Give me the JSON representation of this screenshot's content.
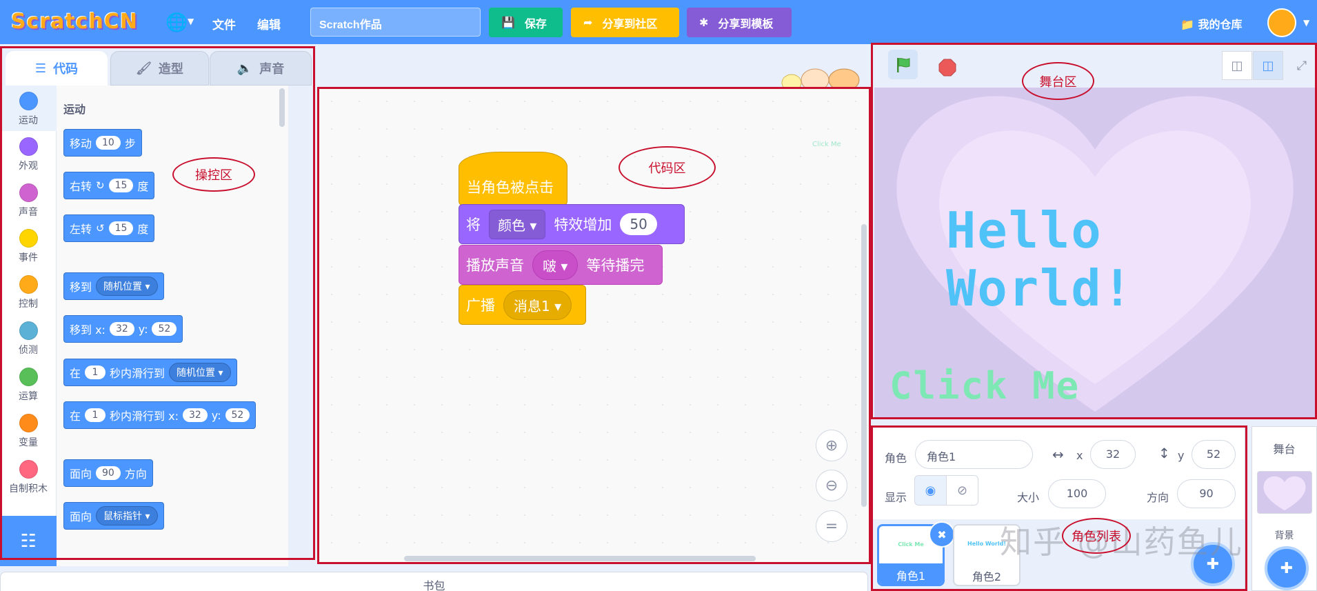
{
  "menubar": {
    "logo": "ScratchCN",
    "menu_file": "文件",
    "menu_edit": "编辑",
    "project_title": "Scratch作品",
    "save_label": "保存",
    "share_community_label": "分享到社区",
    "share_template_label": "分享到模板",
    "my_stuff_label": "我的仓库",
    "bar_color": "#4c97ff"
  },
  "editor_tabs": {
    "code": "代码",
    "costumes": "造型",
    "sounds": "声音"
  },
  "categories": [
    {
      "label": "运动",
      "color": "#4c97ff"
    },
    {
      "label": "外观",
      "color": "#9966ff"
    },
    {
      "label": "声音",
      "color": "#cf63cf"
    },
    {
      "label": "事件",
      "color": "#ffd500"
    },
    {
      "label": "控制",
      "color": "#ffab19"
    },
    {
      "label": "侦测",
      "color": "#5cb1d6"
    },
    {
      "label": "运算",
      "color": "#59c059"
    },
    {
      "label": "变量",
      "color": "#ff8c1a"
    },
    {
      "label": "自制积木",
      "color": "#ff6680"
    }
  ],
  "palette": {
    "heading": "运动",
    "move": {
      "a": "移动",
      "n": "10",
      "b": "步"
    },
    "turn_right": {
      "a": "右转",
      "n": "15",
      "b": "度"
    },
    "turn_left": {
      "a": "左转",
      "n": "15",
      "b": "度"
    },
    "goto": {
      "a": "移到",
      "drop": "随机位置"
    },
    "goto_xy": {
      "a": "移到 x:",
      "x": "32",
      "ylab": "y:",
      "y": "52"
    },
    "glide": {
      "a": "在",
      "n": "1",
      "b": "秒内滑行到",
      "drop": "随机位置"
    },
    "glide_xy": {
      "a": "在",
      "n": "1",
      "b": "秒内滑行到 x:",
      "x": "32",
      "ylab": "y:",
      "y": "52"
    },
    "point_dir": {
      "a": "面向",
      "n": "90",
      "b": "方向"
    },
    "point_towards": {
      "a": "面向",
      "drop": "鼠标指针"
    }
  },
  "script": {
    "hat": "当角色被点击",
    "effect": {
      "a": "将",
      "drop": "颜色",
      "b": "特效增加",
      "n": "50"
    },
    "sound": {
      "a": "播放声音",
      "drop": "啵",
      "b": "等待播完"
    },
    "broadcast": {
      "a": "广播",
      "drop": "消息1"
    }
  },
  "stage": {
    "hello_text": "Hello World!",
    "click_text": "Click Me",
    "mini_click_text": "Click Me"
  },
  "sprite_info": {
    "sprite_label": "角色",
    "sprite_name": "角色1",
    "x_label": "x",
    "x": "32",
    "y_label": "y",
    "y": "52",
    "show_label": "显示",
    "size_label": "大小",
    "size": "100",
    "direction_label": "方向",
    "direction": "90"
  },
  "sprites": [
    {
      "name": "角色1",
      "mini": "Click Me",
      "mini_color": "#7ee8b4"
    },
    {
      "name": "角色2",
      "mini": "Hello World!",
      "mini_color": "#4fc3f7"
    }
  ],
  "stage_selector": {
    "title": "舞台",
    "backdrop_label": "背景"
  },
  "backpack_label": "书包",
  "annotations": {
    "control_area": "操控区",
    "code_area": "代码区",
    "stage_area": "舞台区",
    "sprite_list": "角色列表"
  },
  "watermark": "知乎 @山药鱼儿"
}
